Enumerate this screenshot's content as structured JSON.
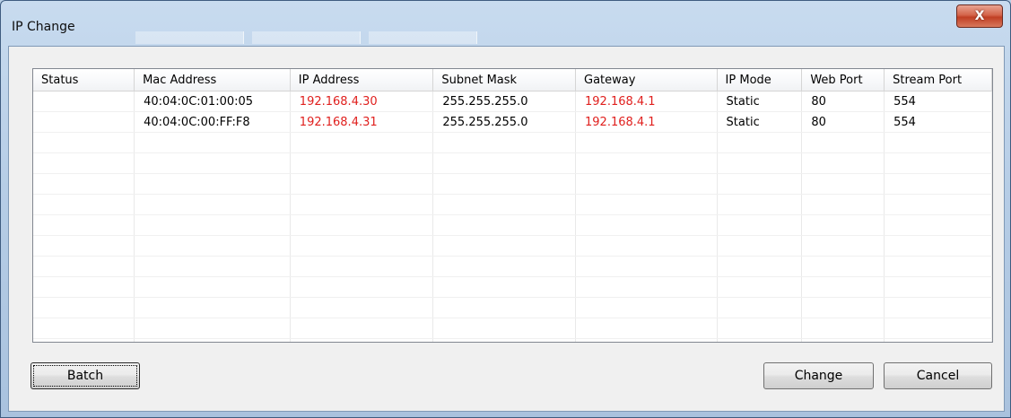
{
  "window": {
    "title": "IP Change",
    "close_symbol": "X"
  },
  "table": {
    "columns": [
      "Status",
      "Mac Address",
      "IP Address",
      "Subnet Mask",
      "Gateway",
      "IP Mode",
      "Web Port",
      "Stream Port"
    ],
    "rows": [
      [
        "",
        "40:04:0C:01:00:05",
        "192.168.4.30",
        "255.255.255.0",
        "192.168.4.1",
        "Static",
        "80",
        "554"
      ],
      [
        "",
        "40:04:0C:00:FF:F8",
        "192.168.4.31",
        "255.255.255.0",
        "192.168.4.1",
        "Static",
        "80",
        "554"
      ]
    ],
    "highlight_color": "#e0201e"
  },
  "buttons": {
    "batch": "Batch",
    "change": "Change",
    "cancel": "Cancel"
  }
}
